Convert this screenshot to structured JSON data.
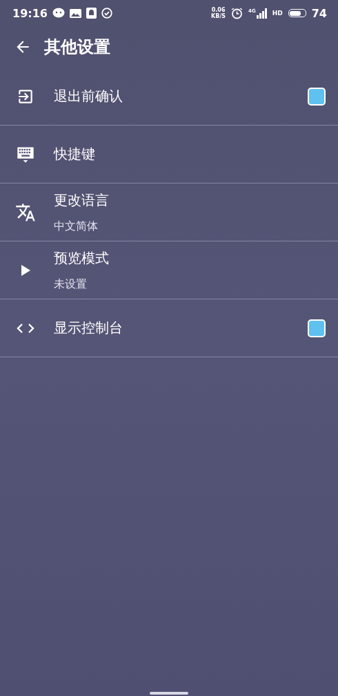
{
  "status_bar": {
    "time": "19:16",
    "net_speed_value": "0.06",
    "net_speed_unit": "KB/S",
    "network": "4G",
    "hd": "HD",
    "battery": "74"
  },
  "app_bar": {
    "title": "其他设置"
  },
  "settings": [
    {
      "kind": "checkbox",
      "title": "退出前确认",
      "checked": true
    },
    {
      "kind": "plain",
      "title": "快捷键"
    },
    {
      "kind": "subtitle",
      "title": "更改语言",
      "subtitle": "中文简体"
    },
    {
      "kind": "subtitle",
      "title": "预览模式",
      "subtitle": "未设置"
    },
    {
      "kind": "checkbox",
      "title": "显示控制台",
      "checked": true
    }
  ]
}
